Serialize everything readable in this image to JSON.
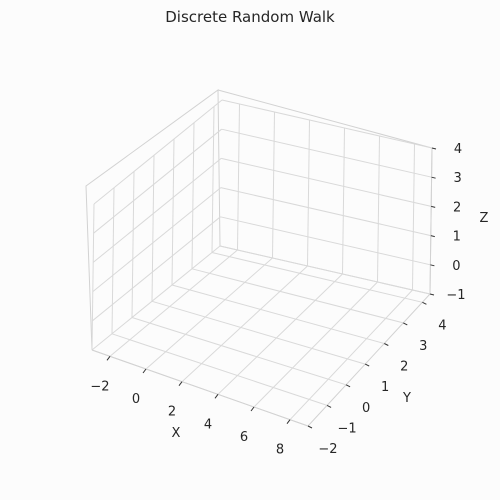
{
  "chart_data": {
    "type": "line",
    "title": "Discrete Random Walk",
    "xlabel": "X",
    "ylabel": "Y",
    "zlabel": "Z",
    "xlim": [
      -3,
      9
    ],
    "ylim": [
      -2,
      4.4
    ],
    "zlim": [
      -1,
      4
    ],
    "x_ticks": [
      -2,
      0,
      2,
      4,
      6,
      8
    ],
    "y_ticks": [
      -2,
      -1,
      0,
      1,
      2,
      3,
      4
    ],
    "z_ticks": [
      -1,
      0,
      1,
      2,
      3,
      4
    ],
    "x_tick_labels": [
      "−2",
      "0",
      "2",
      "4",
      "6",
      "8"
    ],
    "y_tick_labels": [
      "−2",
      "−1",
      "0",
      "1",
      "2",
      "3",
      "4"
    ],
    "z_tick_labels": [
      "−1",
      "0",
      "1",
      "2",
      "3",
      "4"
    ],
    "grid": true,
    "series": []
  }
}
